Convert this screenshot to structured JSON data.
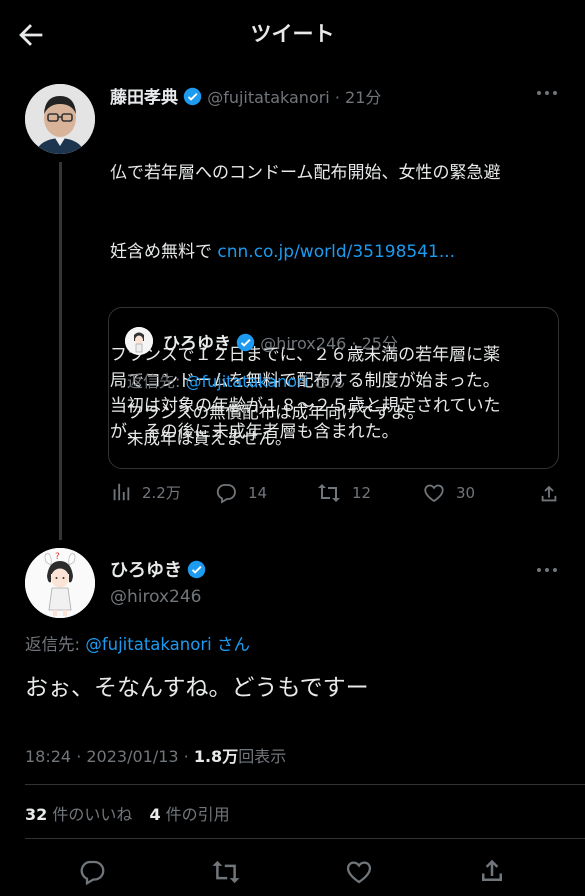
{
  "header": {
    "title": "ツイート"
  },
  "tweet": {
    "author_name": "藤田孝典",
    "author_handle": "@fujitatakanori",
    "time": "· 21分",
    "line1": "仏で若年層へのコンドーム配布開始、女性の緊急避",
    "line2_prefix": "妊含め無料で ",
    "link": "cnn.co.jp/world/35198541...",
    "paragraph": "フランスで１２日までに、２６歳未満の若年層に薬\n局でコンドームを無料で配布する制度が始まった。\n当初は対象の年齢が１８～２５歳と規定されていた\nが、その後に未成年者層も含まれた。",
    "quote": {
      "author_name": "ひろゆき",
      "author_handle": "@hirox246",
      "time": "· 25分",
      "reply_prefix": "返信先: ",
      "reply_handle": "@fujitatakanori",
      "reply_suffix": " さん",
      "text": "フランスの無償配布は成年向けですよ。\n未成年は貰えません。"
    },
    "stats": {
      "views": "2.2万",
      "replies": "14",
      "retweets": "12",
      "likes": "30"
    }
  },
  "reply": {
    "author_name": "ひろゆき",
    "author_handle": "@hirox246",
    "reply_prefix": "返信先: ",
    "reply_handle": "@fujitatakanori",
    "reply_suffix": " さん",
    "text": "おぉ、そなんすね。どうもですー",
    "timestamp": "18:24 · 2023/01/13 · ",
    "views_count": "1.8万",
    "views_label": "回表示",
    "likes_count": "32",
    "likes_label": " 件のいいね",
    "quotes_count": "4",
    "quotes_label": " 件の引用"
  }
}
